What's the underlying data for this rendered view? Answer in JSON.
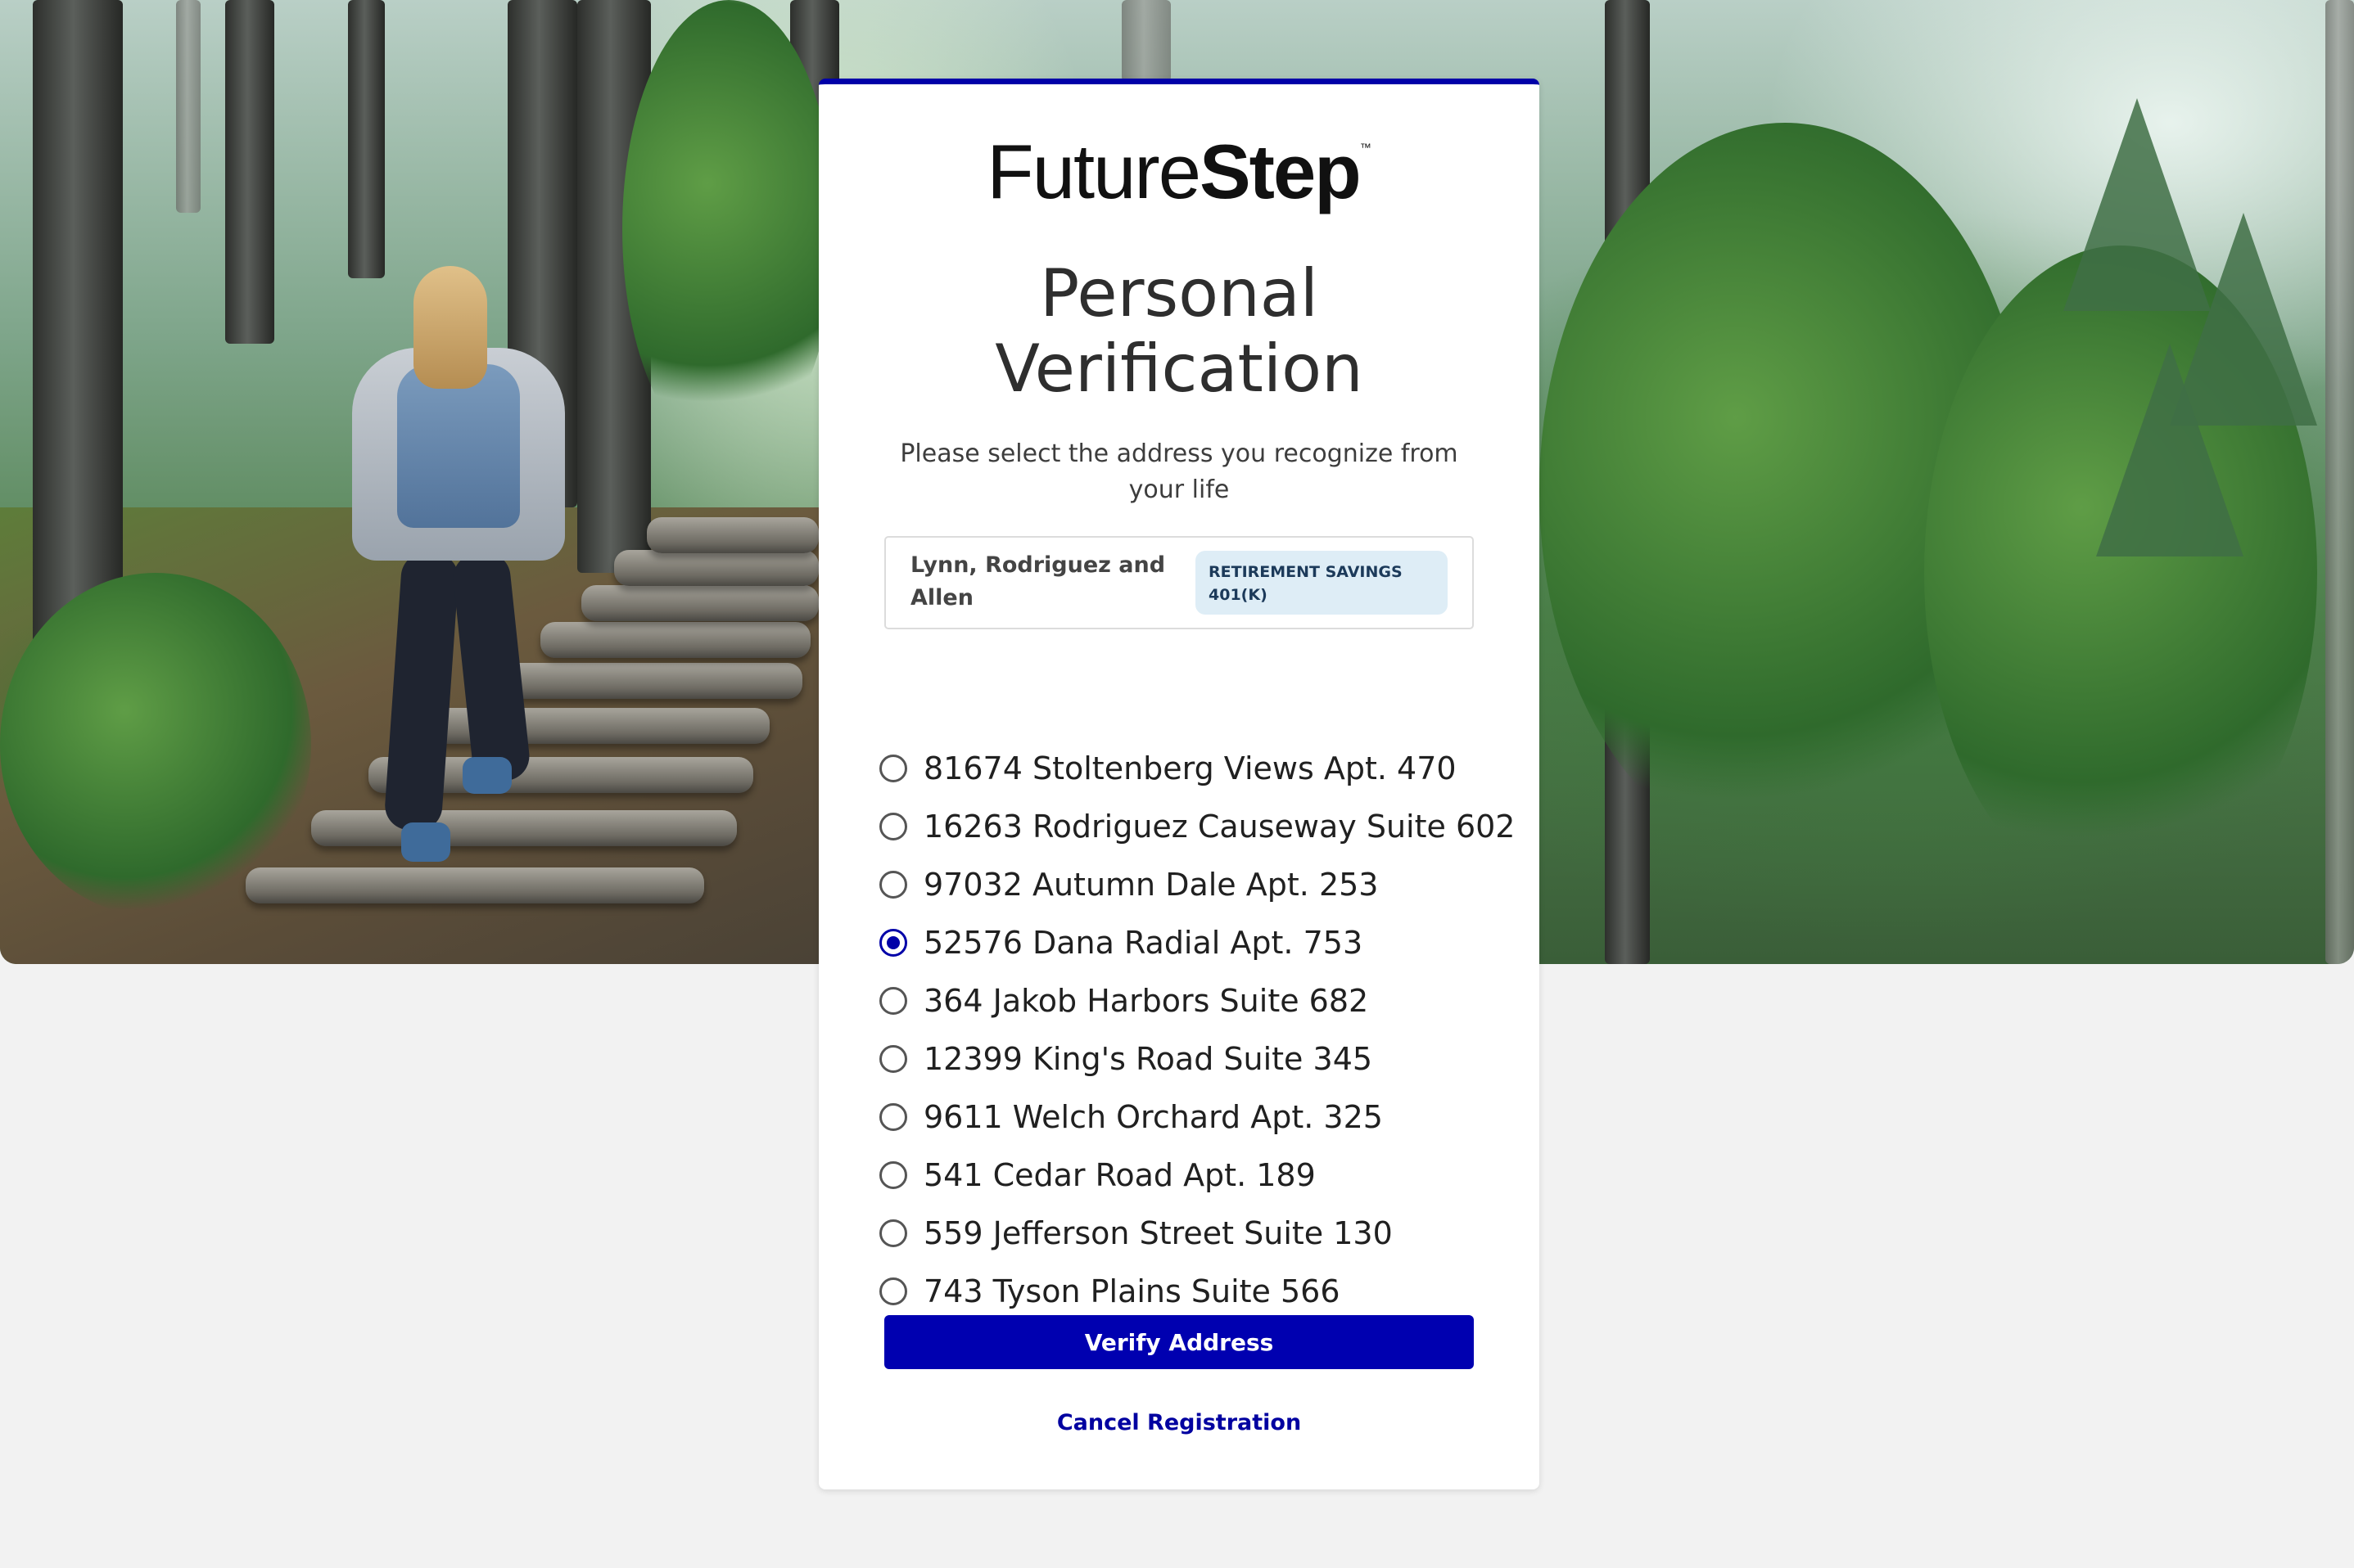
{
  "brand": {
    "logo_regular": "Future",
    "logo_bold": "Step",
    "logo_mark": "™"
  },
  "page": {
    "title": "Personal Verification",
    "subtitle": "Please select the address you recognize from your life"
  },
  "account": {
    "name": "Lynn, Rodriguez and Allen",
    "badge": "RETIREMENT SAVINGS 401(K)"
  },
  "addresses": [
    {
      "label": "81674 Stoltenberg Views Apt. 470",
      "selected": false
    },
    {
      "label": "16263 Rodriguez Causeway Suite 602",
      "selected": false
    },
    {
      "label": "97032 Autumn Dale Apt. 253",
      "selected": false
    },
    {
      "label": "52576 Dana Radial Apt. 753",
      "selected": true
    },
    {
      "label": "364 Jakob Harbors Suite 682",
      "selected": false
    },
    {
      "label": "12399 King's Road Suite 345",
      "selected": false
    },
    {
      "label": "9611 Welch Orchard Apt. 325",
      "selected": false
    },
    {
      "label": "541 Cedar Road Apt. 189",
      "selected": false
    },
    {
      "label": "559 Jefferson Street Suite 130",
      "selected": false
    },
    {
      "label": "743 Tyson Plains Suite 566",
      "selected": false
    }
  ],
  "actions": {
    "verify_label": "Verify Address",
    "cancel_label": "Cancel Registration"
  },
  "colors": {
    "accent": "#0000a8",
    "badge_bg": "#deedf6",
    "page_bg": "#f2f2f2"
  },
  "hero": {
    "icon": "forest-hiker-image"
  }
}
